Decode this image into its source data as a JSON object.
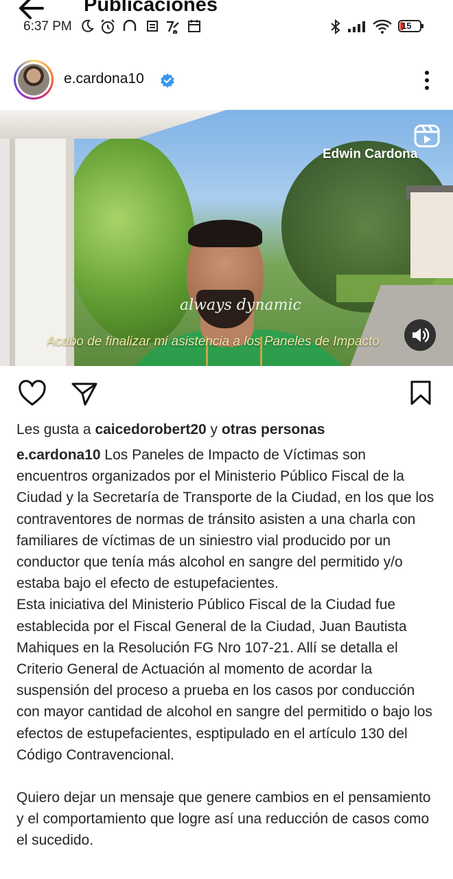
{
  "header": {
    "title": "Publicaciones"
  },
  "status_bar": {
    "time": "6:37 PM",
    "battery": "15"
  },
  "post": {
    "username": "e.cardona10",
    "video": {
      "brand_label": "Edwin Cardona",
      "caption_overlay": "Acabo de finalizar mi asistencia a los Paneles de Impacto",
      "shirt_text": "always dynamic"
    },
    "likes": {
      "prefix": "Les gusta a",
      "user": "caicedorobert20",
      "connector": "y",
      "others": "otras personas"
    },
    "caption": {
      "user": "e.cardona10",
      "p1": "Los Paneles de Impacto de Víctimas son encuentros organizados por el Ministerio Público Fiscal de la Ciudad y la Secretaría de Transporte de la Ciudad, en los que los contraventores de normas de tránsito asisten a una charla con familiares de víctimas de un siniestro vial producido por un conductor que tenía más alcohol en sangre del permitido y/o estaba bajo el efecto de estupefacientes.",
      "p2": "Esta iniciativa del Ministerio Público Fiscal de la Ciudad fue establecida por el Fiscal General de la Ciudad, Juan Bautista Mahiques en la Resolución FG Nro 107-21. Allí se detalla el Criterio General de Actuación al momento de acordar la suspensión del proceso a prueba en los casos por conducción con mayor cantidad de alcohol en sangre del permitido o bajo los efectos de estupefacientes, esptipulado en el artículo 130 del Código Contravencional.",
      "p3": "Quiero dejar un mensaje que genere cambios en el pensamiento y el comportamiento que logre así una reducción de casos como el sucedido."
    }
  },
  "icons": {
    "back": "arrow-left-icon",
    "more": "more-vertical-icon",
    "like": "heart-icon",
    "share": "paper-plane-icon",
    "save": "bookmark-icon",
    "reels": "reels-icon",
    "sound": "speaker-icon",
    "verified": "verified-badge-icon"
  },
  "colors": {
    "verified": "#3897f0",
    "text": "#262626",
    "shirt": "#23924a"
  }
}
